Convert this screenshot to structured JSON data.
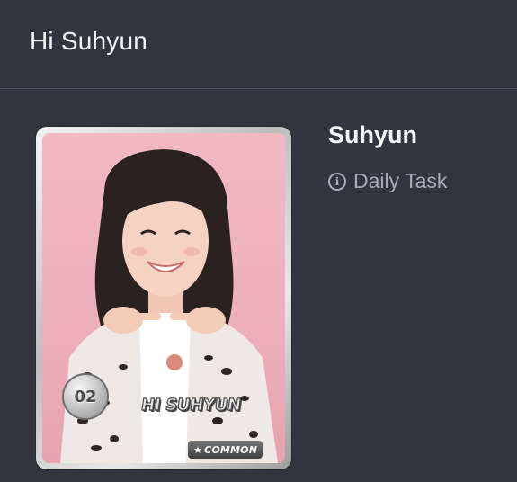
{
  "header": {
    "title": "Hi Suhyun"
  },
  "card": {
    "number": "02",
    "name": "HI SUHYUN",
    "rarity": "COMMON",
    "rarity_icon": "star-icon"
  },
  "detail": {
    "name": "Suhyun",
    "task_label": "Daily Task",
    "task_icon": "info-icon"
  },
  "colors": {
    "background": "#32343f",
    "divider": "#4a4d5a",
    "secondary_text": "#a9acb8",
    "card_background": "#f1b9c2"
  }
}
